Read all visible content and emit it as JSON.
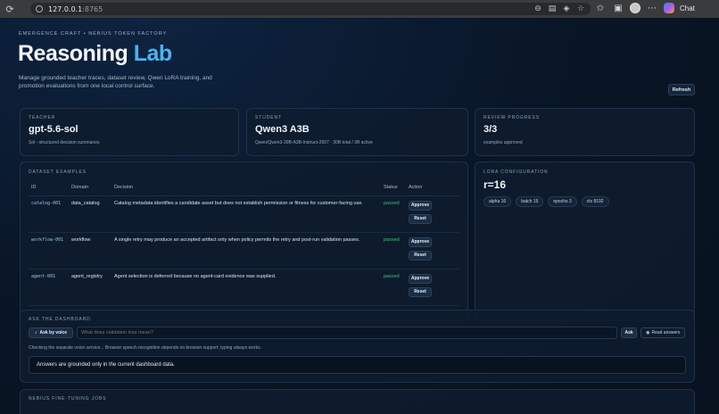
{
  "browser": {
    "url_host": "127.0.0.1",
    "url_port": ":8765",
    "chat_label": "Chat"
  },
  "header": {
    "eyebrow": "EMERGENCE CRAFT • NEBIUS TOKEN FACTORY",
    "title_main": "Reasoning",
    "title_accent": "Lab",
    "intro": "Manage grounded teacher traces, dataset review, Qwen LoRA training, and promotion evaluations from one local control surface.",
    "refresh_label": "Refresh"
  },
  "stats": {
    "teacher": {
      "label": "TEACHER",
      "value": "gpt-5.6-sol",
      "sub": "Sol - structured decision summaries"
    },
    "student": {
      "label": "STUDENT",
      "value": "Qwen3 A3B",
      "sub": "Qwen/Qwen3-30B-A3B-Instruct-2507 · 30B total / 3B active"
    },
    "review": {
      "label": "REVIEW PROGRESS",
      "value": "3/3",
      "sub": "examples approved"
    }
  },
  "dataset": {
    "label": "DATASET EXAMPLES",
    "columns": [
      "ID",
      "Domain",
      "Decision",
      "Status",
      "Action"
    ],
    "approve_label": "Approve",
    "reset_label": "Reset",
    "rows": [
      {
        "id": "catalog-001",
        "domain": "data_catalog",
        "decision": "Catalog metadata identifies a candidate asset but does not establish permission or fitness for customer-facing use.",
        "status": "passed"
      },
      {
        "id": "workflow-001",
        "domain": "workflow",
        "decision": "A single retry may produce an accepted artifact only when policy permits the retry and post-run validation passes.",
        "status": "passed"
      },
      {
        "id": "agent-001",
        "domain": "agent_registry",
        "decision": "Agent selection is deferred because no agent-card evidence was supplied.",
        "status": "passed"
      }
    ]
  },
  "lora": {
    "label": "LORA CONFIGURATION",
    "value": "r=16",
    "chips": [
      "alpha 16",
      "batch 16",
      "epochs 3",
      "ctx 8192"
    ]
  },
  "ask": {
    "label": "ASK THE DASHBOARD",
    "voice_label": "Ask by voice",
    "placeholder": "What does validation loss mean?",
    "ask_label": "Ask",
    "read_label": "Read answers",
    "note": "Checking the separate voice service... Browser speech recognition depends on browser support; typing always works.",
    "answer": "Answers are grounded only in the current dashboard data."
  },
  "jobs": {
    "label": "NEBIUS FINE-TUNING JOBS"
  }
}
